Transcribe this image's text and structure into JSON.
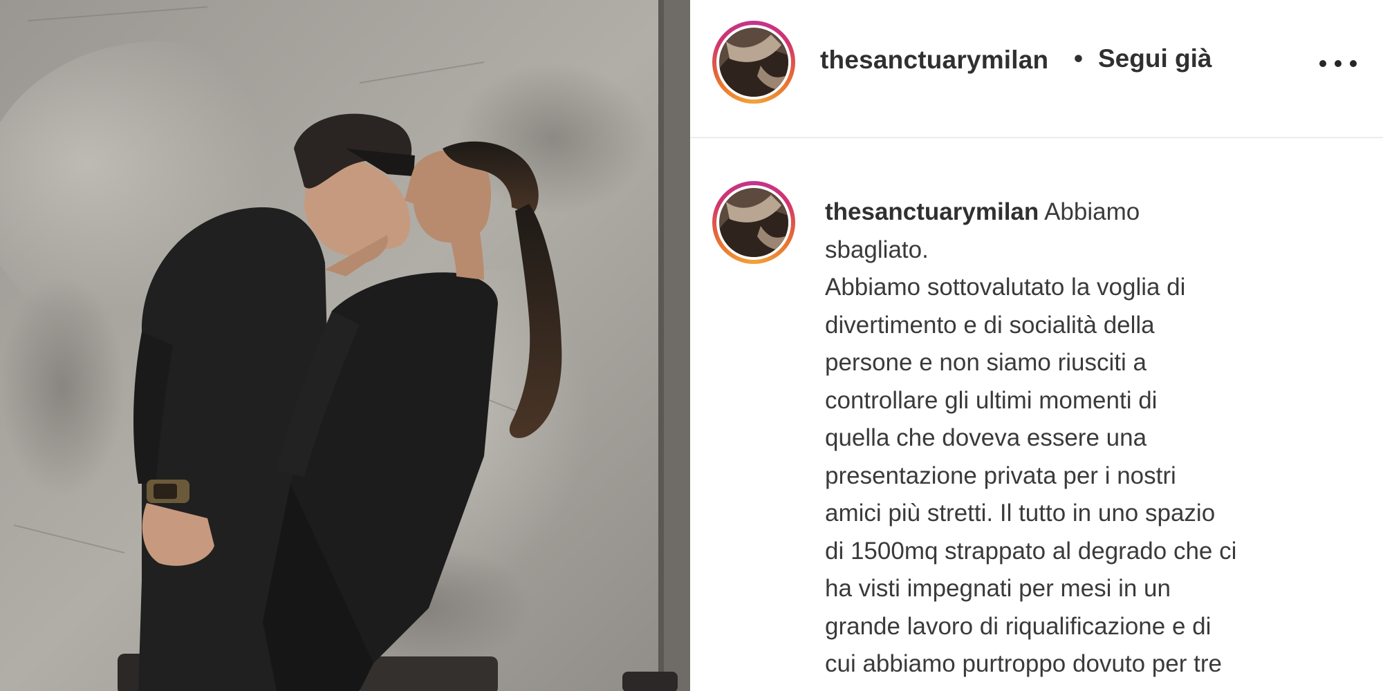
{
  "post": {
    "username": "thesanctuarymilan",
    "separator": "•",
    "follow_state": "Segui già",
    "more_icon": "more-horizontal-icon"
  },
  "caption": {
    "username": "thesanctuarymilan",
    "first_line_text": "Abbiamo",
    "lines": [
      "sbagliato.",
      "Abbiamo sottovalutato la voglia di",
      "divertimento e di socialità della",
      "persone e non siamo riusciti a",
      "controllare gli ultimi momenti di",
      "quella che doveva essere una",
      "presentazione privata per i nostri",
      "amici più stretti. Il tutto in uno spazio",
      "di 1500mq strappato al degrado che ci",
      "ha visti impegnati per mesi in un",
      "grande lavoro di riqualificazione e di",
      "cui abbiamo purtroppo dovuto per tre"
    ]
  },
  "colors": {
    "text": "#303030",
    "divider": "#ececec",
    "ring_start": "#c1358f",
    "ring_end": "#f2a33c"
  }
}
